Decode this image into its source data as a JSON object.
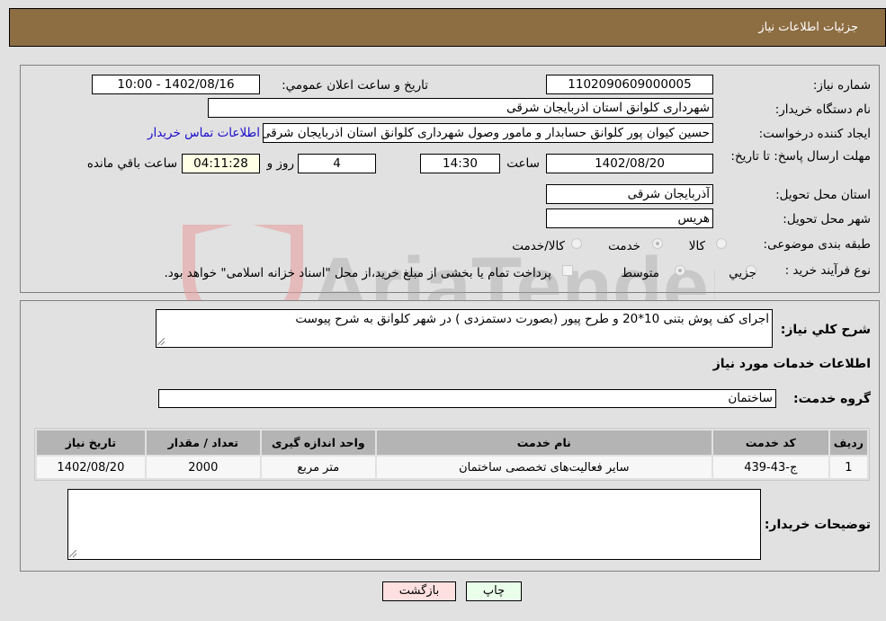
{
  "header": {
    "title": "جزئیات اطلاعات نیاز"
  },
  "need_info": {
    "need_number": {
      "label": "شماره نیاز:",
      "value": "1102090609000005"
    },
    "announce_datetime": {
      "label": "تاریخ و ساعت اعلان عمومي:",
      "value": "1402/08/16 - 10:00"
    },
    "buyer_org": {
      "label": "نام دستگاه خریدار:",
      "value": "شهرداری کلوانق استان اذربایجان شرقی"
    },
    "requester": {
      "label": "ایجاد کننده درخواست:",
      "value": "حسین  کیوان پور کلوانق حسابدار و مامور وصول شهرداری کلوانق استان اذربایجان شرقی"
    },
    "buyer_contact_link": "اطلاعات تماس خریدار",
    "deadline": {
      "label": "مهلت ارسال پاسخ: تا تاریخ:",
      "date": "1402/08/20",
      "time_label": "ساعت",
      "time": "14:30",
      "days": "4",
      "days_label": "روز و",
      "remaining": "04:11:28",
      "remaining_label": "ساعت باقي مانده"
    },
    "delivery_province": {
      "label": "استان محل تحویل:",
      "value": "آذربایجان شرقی"
    },
    "delivery_city": {
      "label": "شهر محل تحویل:",
      "value": "هریس"
    },
    "category": {
      "label": "طبقه بندی موضوعی:",
      "options": [
        "کالا",
        "خدمت",
        "کالا/خدمت"
      ],
      "selected": "خدمت"
    },
    "purchase_process": {
      "label": "نوع فرآیند خرید :",
      "options": [
        "جزيي",
        "متوسط"
      ],
      "selected": "متوسط",
      "treasury_checkbox_label": "پرداخت تمام یا بخشی از مبلغ خرید،از محل \"اسناد خزانه اسلامی\" خواهد بود.",
      "treasury_checked": false
    }
  },
  "description": {
    "label": "شرح کلي نیاز:",
    "value": "اجرای کف پوش بتنی 10*20 و طرح پیور (بصورت دستمزدی ) در شهر کلوانق به شرح پیوست"
  },
  "services": {
    "section_title": "اطلاعات خدمات مورد نیاز",
    "group_label": "گروه خدمت:",
    "group_value": "ساختمان",
    "columns": [
      "ردیف",
      "کد خدمت",
      "نام خدمت",
      "واحد اندازه گیری",
      "تعداد / مقدار",
      "تاریخ نیاز"
    ],
    "rows": [
      [
        "1",
        "ج-43-439",
        "سایر فعالیت‌های تخصصی ساختمان",
        "متر مربع",
        "2000",
        "1402/08/20"
      ]
    ]
  },
  "buyer_notes": {
    "label": "توضیحات خریدار:",
    "value": ""
  },
  "buttons": {
    "print": "چاپ",
    "back": "بازگشت"
  },
  "watermark": {
    "text": "AriaTender.neT"
  },
  "colors": {
    "header_bg": "#8d6d42",
    "link": "#1a0dcc",
    "print_bg": "#eaffea",
    "back_bg": "#ffe0e0",
    "timer_bg": "#ffffe6"
  }
}
